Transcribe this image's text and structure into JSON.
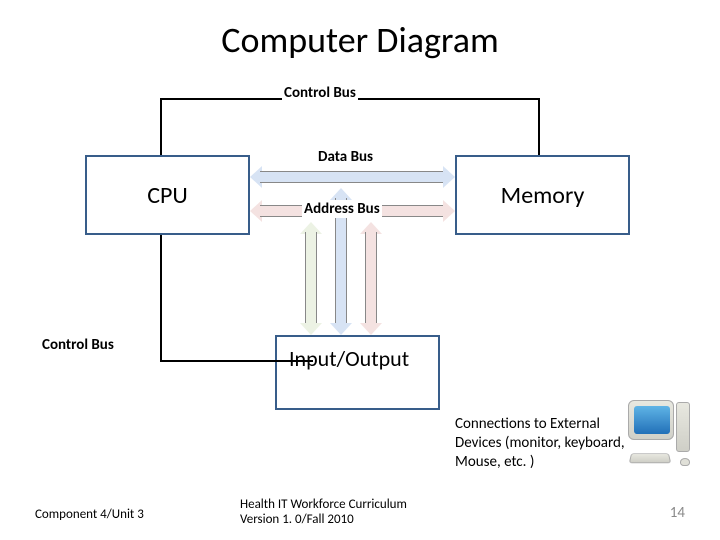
{
  "title": "Computer Diagram",
  "blocks": {
    "cpu": "CPU",
    "memory": "Memory",
    "io": "Input/Output"
  },
  "buses": {
    "control_top": "Control Bus",
    "data": "Data Bus",
    "address": "Address Bus",
    "control_left": "Control Bus"
  },
  "note": "Connections to External Devices (monitor, keyboard, Mouse, etc. )",
  "footer": {
    "left": "Component 4/Unit 3",
    "center_line1": "Health IT Workforce Curriculum",
    "center_line2": "Version 1. 0/Fall 2010",
    "page": "14"
  }
}
